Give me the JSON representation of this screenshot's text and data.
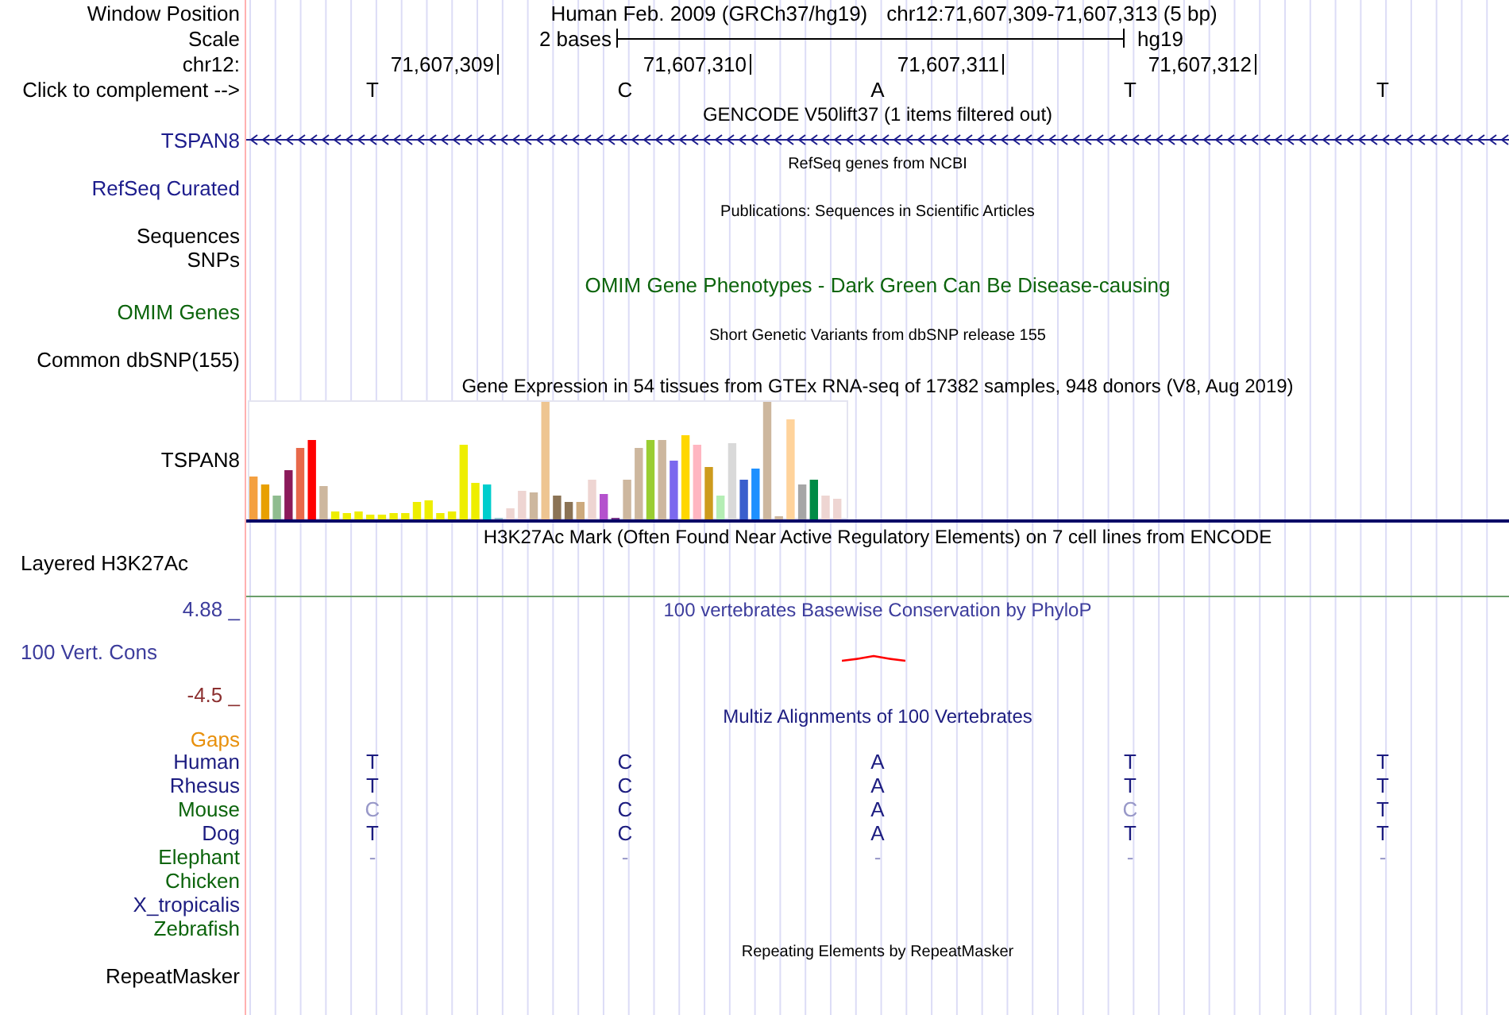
{
  "window_position": {
    "label": "Window Position",
    "assembly": "Human Feb. 2009 (GRCh37/hg19)",
    "position": "chr12:71,607,309-71,607,313 (5 bp)"
  },
  "scale": {
    "label": "Scale",
    "span": "2 bases",
    "assembly": "hg19"
  },
  "chromosome": {
    "label": "chr12:",
    "ticks": [
      "71,607,309",
      "71,607,310",
      "71,607,311",
      "71,607,312"
    ]
  },
  "complement": {
    "label": "Click to complement -->",
    "bases": [
      "T",
      "C",
      "A",
      "T",
      "T"
    ]
  },
  "tracks": [
    {
      "kind": "gene",
      "title": {
        "text": "GENCODE V50lift37 (1 items filtered out)",
        "color": "#000000"
      },
      "labels": [
        {
          "text": "TSPAN8",
          "color": "#1c1c8c"
        }
      ]
    },
    {
      "kind": "annotation",
      "title": {
        "text": "RefSeq genes from NCBI",
        "color": "#000000"
      },
      "labels": [
        {
          "text": "RefSeq Curated",
          "color": "#1c1c8c"
        }
      ]
    },
    {
      "kind": "annotation",
      "title": {
        "text": "Publications: Sequences in Scientific Articles",
        "color": "#000000"
      },
      "labels": [
        {
          "text": "Sequences",
          "color": "#000000"
        },
        {
          "text": "SNPs",
          "color": "#000000"
        }
      ]
    },
    {
      "kind": "phenotype",
      "title": {
        "text": "OMIM Gene Phenotypes - Dark Green Can Be Disease-causing",
        "color": "#0c640c"
      },
      "labels": [
        {
          "text": "OMIM Genes",
          "color": "#0c640c"
        }
      ]
    },
    {
      "kind": "annotation",
      "title": {
        "text": "Short Genetic Variants from dbSNP release 155",
        "color": "#000000"
      },
      "labels": [
        {
          "text": "Common dbSNP(155)",
          "color": "#000000"
        }
      ]
    },
    {
      "kind": "expression",
      "title": {
        "text": "Gene Expression in 54 tissues from GTEx RNA-seq of 17382 samples, 948 donors (V8, Aug 2019)",
        "color": "#000000"
      },
      "labels": [
        {
          "text": "TSPAN8",
          "color": "#000000"
        }
      ]
    },
    {
      "kind": "signal",
      "title": {
        "text": "H3K27Ac Mark (Often Found Near Active Regulatory Elements) on 7 cell lines from ENCODE",
        "color": "#000000"
      },
      "labels": [
        {
          "text": "Layered H3K27Ac",
          "color": "#000000"
        }
      ]
    },
    {
      "kind": "conservation",
      "title": {
        "text": "100 vertebrates Basewise Conservation by PhyloP",
        "color": "#3c3c9c"
      },
      "labels": [
        {
          "text": "4.88 _",
          "color": "#3c3c9c"
        },
        {
          "text": "100 Vert. Cons",
          "color": "#3c3c9c"
        },
        {
          "text": "-4.5 _",
          "color": "#8c3030"
        }
      ]
    },
    {
      "kind": "alignment",
      "title": {
        "text": "Multiz Alignments of 100 Vertebrates",
        "color": "#1c1c80"
      },
      "labels": [
        {
          "text": "Gaps",
          "color": "#e8900c"
        }
      ],
      "species": [
        {
          "name": "Human",
          "color": "#1c1c80",
          "bases": [
            {
              "text": "T",
              "faded": false
            },
            {
              "text": "C",
              "faded": false
            },
            {
              "text": "A",
              "faded": false
            },
            {
              "text": "T",
              "faded": false
            },
            {
              "text": "T",
              "faded": false
            }
          ]
        },
        {
          "name": "Rhesus",
          "color": "#1c1c80",
          "bases": [
            {
              "text": "T",
              "faded": false
            },
            {
              "text": "C",
              "faded": false
            },
            {
              "text": "A",
              "faded": false
            },
            {
              "text": "T",
              "faded": false
            },
            {
              "text": "T",
              "faded": false
            }
          ]
        },
        {
          "name": "Mouse",
          "color": "#0c640c",
          "bases": [
            {
              "text": "C",
              "faded": true
            },
            {
              "text": "C",
              "faded": false
            },
            {
              "text": "A",
              "faded": false
            },
            {
              "text": "C",
              "faded": true
            },
            {
              "text": "T",
              "faded": false
            }
          ]
        },
        {
          "name": "Dog",
          "color": "#1c1c80",
          "bases": [
            {
              "text": "T",
              "faded": false
            },
            {
              "text": "C",
              "faded": false
            },
            {
              "text": "A",
              "faded": false
            },
            {
              "text": "T",
              "faded": false
            },
            {
              "text": "T",
              "faded": false
            }
          ]
        },
        {
          "name": "Elephant",
          "color": "#0c640c",
          "bases": [
            {
              "text": "-",
              "faded": true
            },
            {
              "text": "-",
              "faded": true
            },
            {
              "text": "-",
              "faded": true
            },
            {
              "text": "-",
              "faded": true
            },
            {
              "text": "-",
              "faded": true
            }
          ]
        },
        {
          "name": "Chicken",
          "color": "#0c640c"
        },
        {
          "name": "X_tropicalis",
          "color": "#1c1c80"
        },
        {
          "name": "Zebrafish",
          "color": "#0c640c"
        }
      ]
    },
    {
      "kind": "annotation",
      "title": {
        "text": "Repeating Elements by RepeatMasker",
        "color": "#000000"
      },
      "labels": [
        {
          "text": "RepeatMasker",
          "color": "#000000"
        }
      ]
    }
  ]
}
